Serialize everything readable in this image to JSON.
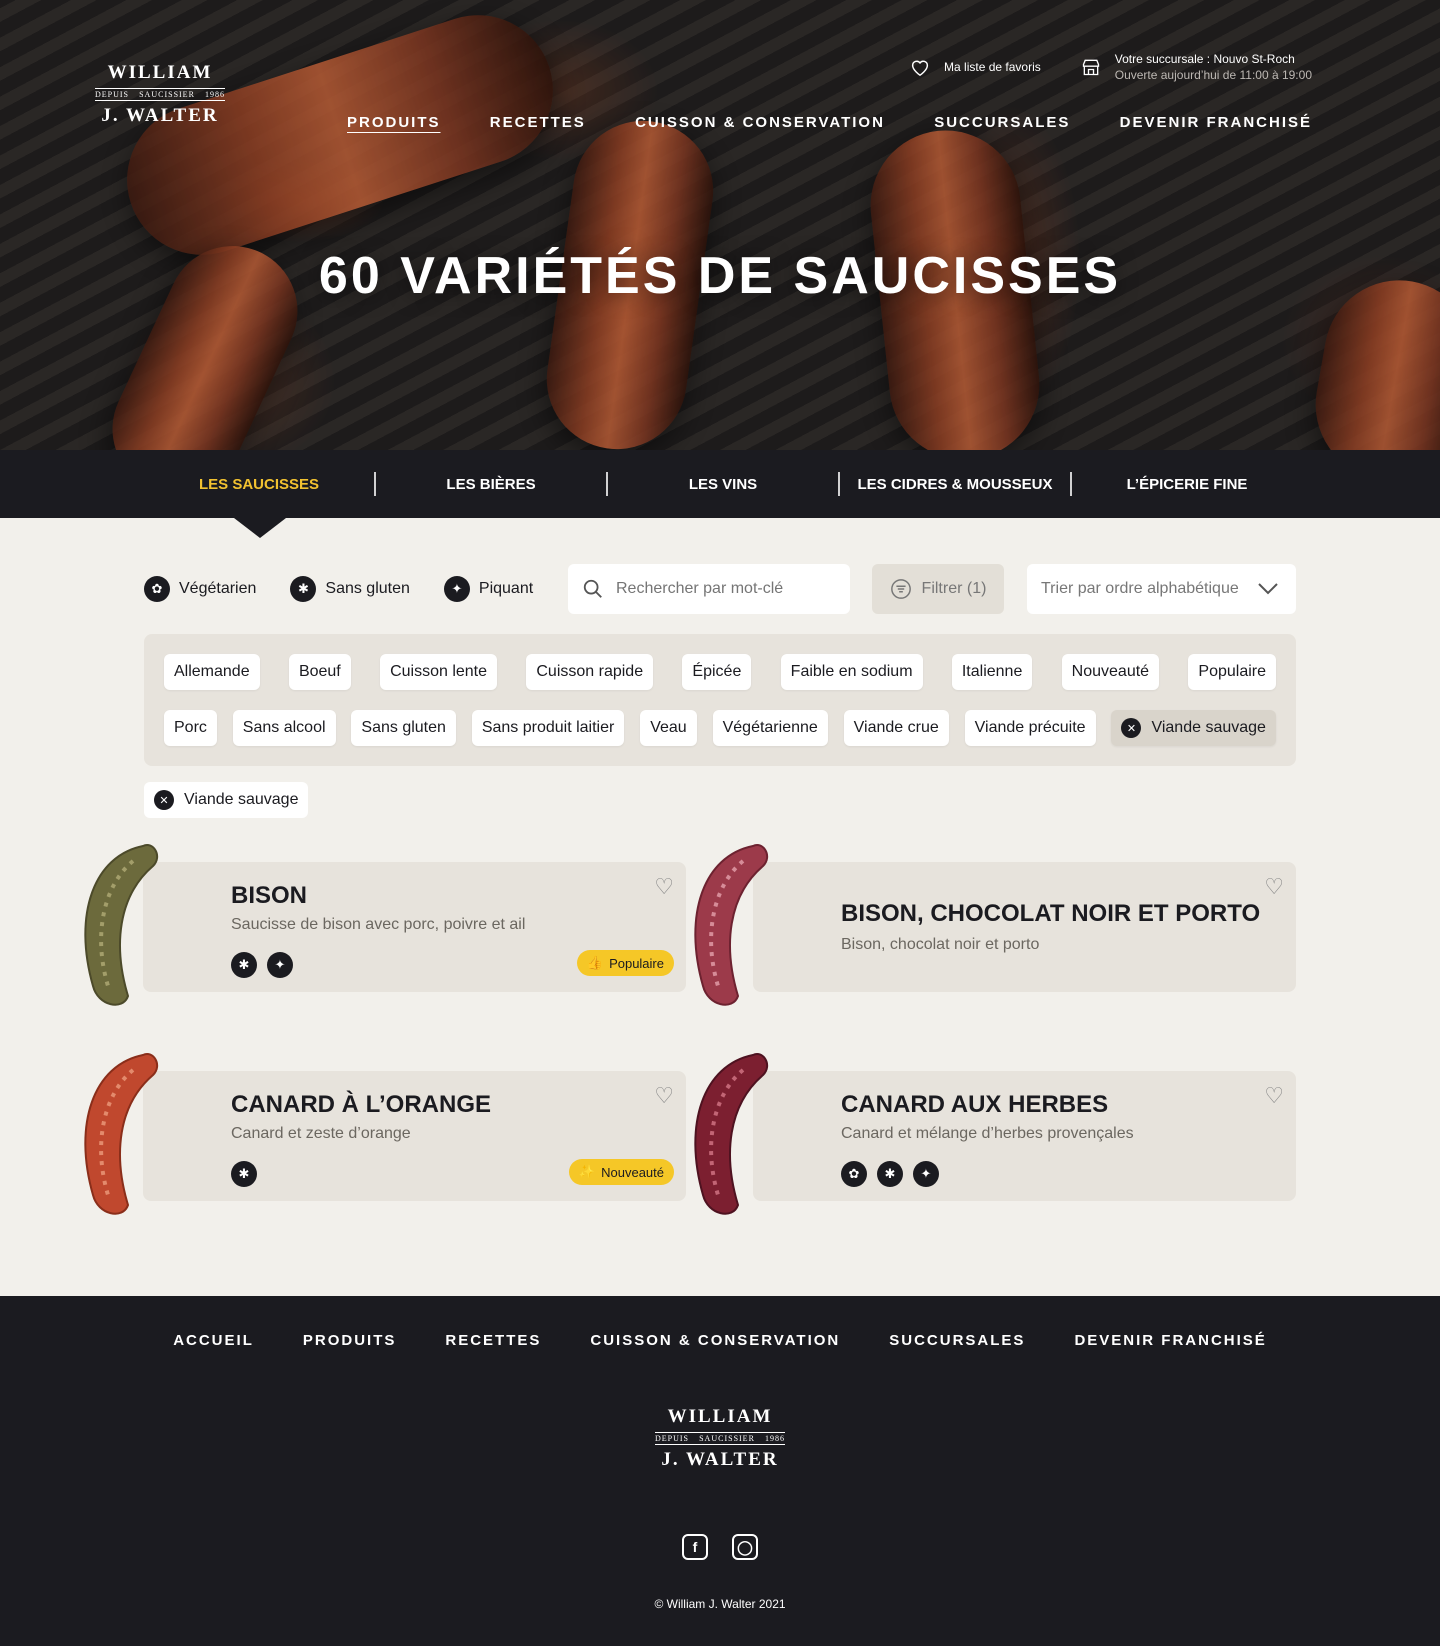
{
  "brand": {
    "logo_top": "WILLIAM",
    "logo_left": "DEPUIS",
    "logo_mid": "SAUCISSIER",
    "logo_right": "1986",
    "logo_bottom": "J. WALTER"
  },
  "header": {
    "favorites_label": "Ma liste de favoris",
    "branch_label": "Votre succursale : Nouvo St-Roch",
    "branch_hours": "Ouverte aujourd’hui de 11:00 à 19:00",
    "nav": [
      "PRODUITS",
      "RECETTES",
      "CUISSON & CONSERVATION",
      "SUCCURSALES",
      "DEVENIR FRANCHISÉ"
    ]
  },
  "hero": {
    "title": "60 VARIÉTÉS DE SAUCISSES"
  },
  "categories": [
    "LES SAUCISSES",
    "LES BIÈRES",
    "LES VINS",
    "LES CIDRES & MOUSSEUX",
    "L’ÉPICERIE FINE"
  ],
  "toggles": [
    "Végétarien",
    "Sans gluten",
    "Piquant"
  ],
  "search": {
    "placeholder": "Rechercher par mot-clé"
  },
  "filter_button": "Filtrer (1)",
  "sort": {
    "selected": "Trier par ordre alphabétique"
  },
  "tags_row1": [
    "Allemande",
    "Boeuf",
    "Cuisson lente",
    "Cuisson rapide",
    "Épicée",
    "Faible en sodium",
    "Italienne",
    "Nouveauté",
    "Populaire"
  ],
  "tags_row2": [
    "Porc",
    "Sans alcool",
    "Sans gluten",
    "Sans produit laitier",
    "Veau",
    "Végétarienne",
    "Viande crue",
    "Viande précuite",
    "Viande sauvage"
  ],
  "active_filter": "Viande sauvage",
  "products": [
    {
      "title": "BISON",
      "desc": "Saucisse de bison avec porc, poivre et ail",
      "badge": "Populaire"
    },
    {
      "title": "BISON, CHOCOLAT NOIR ET PORTO",
      "desc": "Bison, chocolat noir et porto",
      "badge": ""
    },
    {
      "title": "CANARD À L’ORANGE",
      "desc": "Canard et zeste d’orange",
      "badge": "Nouveauté"
    },
    {
      "title": "CANARD AUX HERBES",
      "desc": "Canard et mélange d’herbes provençales",
      "badge": ""
    }
  ],
  "footer": {
    "nav": [
      "ACCUEIL",
      "PRODUITS",
      "RECETTES",
      "CUISSON & CONSERVATION",
      "SUCCURSALES",
      "DEVENIR FRANCHISÉ"
    ],
    "copyright": "© William J. Walter 2021"
  },
  "colors": {
    "accent": "#f2c230",
    "dark": "#1b1b20",
    "background": "#f2f0eb",
    "panel": "#e7e3dc",
    "badge": "#f5c727"
  },
  "icons": [
    "heart-icon",
    "store-icon",
    "search-icon",
    "filter-icon",
    "chevron-down-icon",
    "leaf-icon",
    "wheat-icon",
    "pepper-icon",
    "close-icon",
    "thumbs-up-icon",
    "sparkle-icon",
    "facebook-icon",
    "instagram-icon"
  ]
}
